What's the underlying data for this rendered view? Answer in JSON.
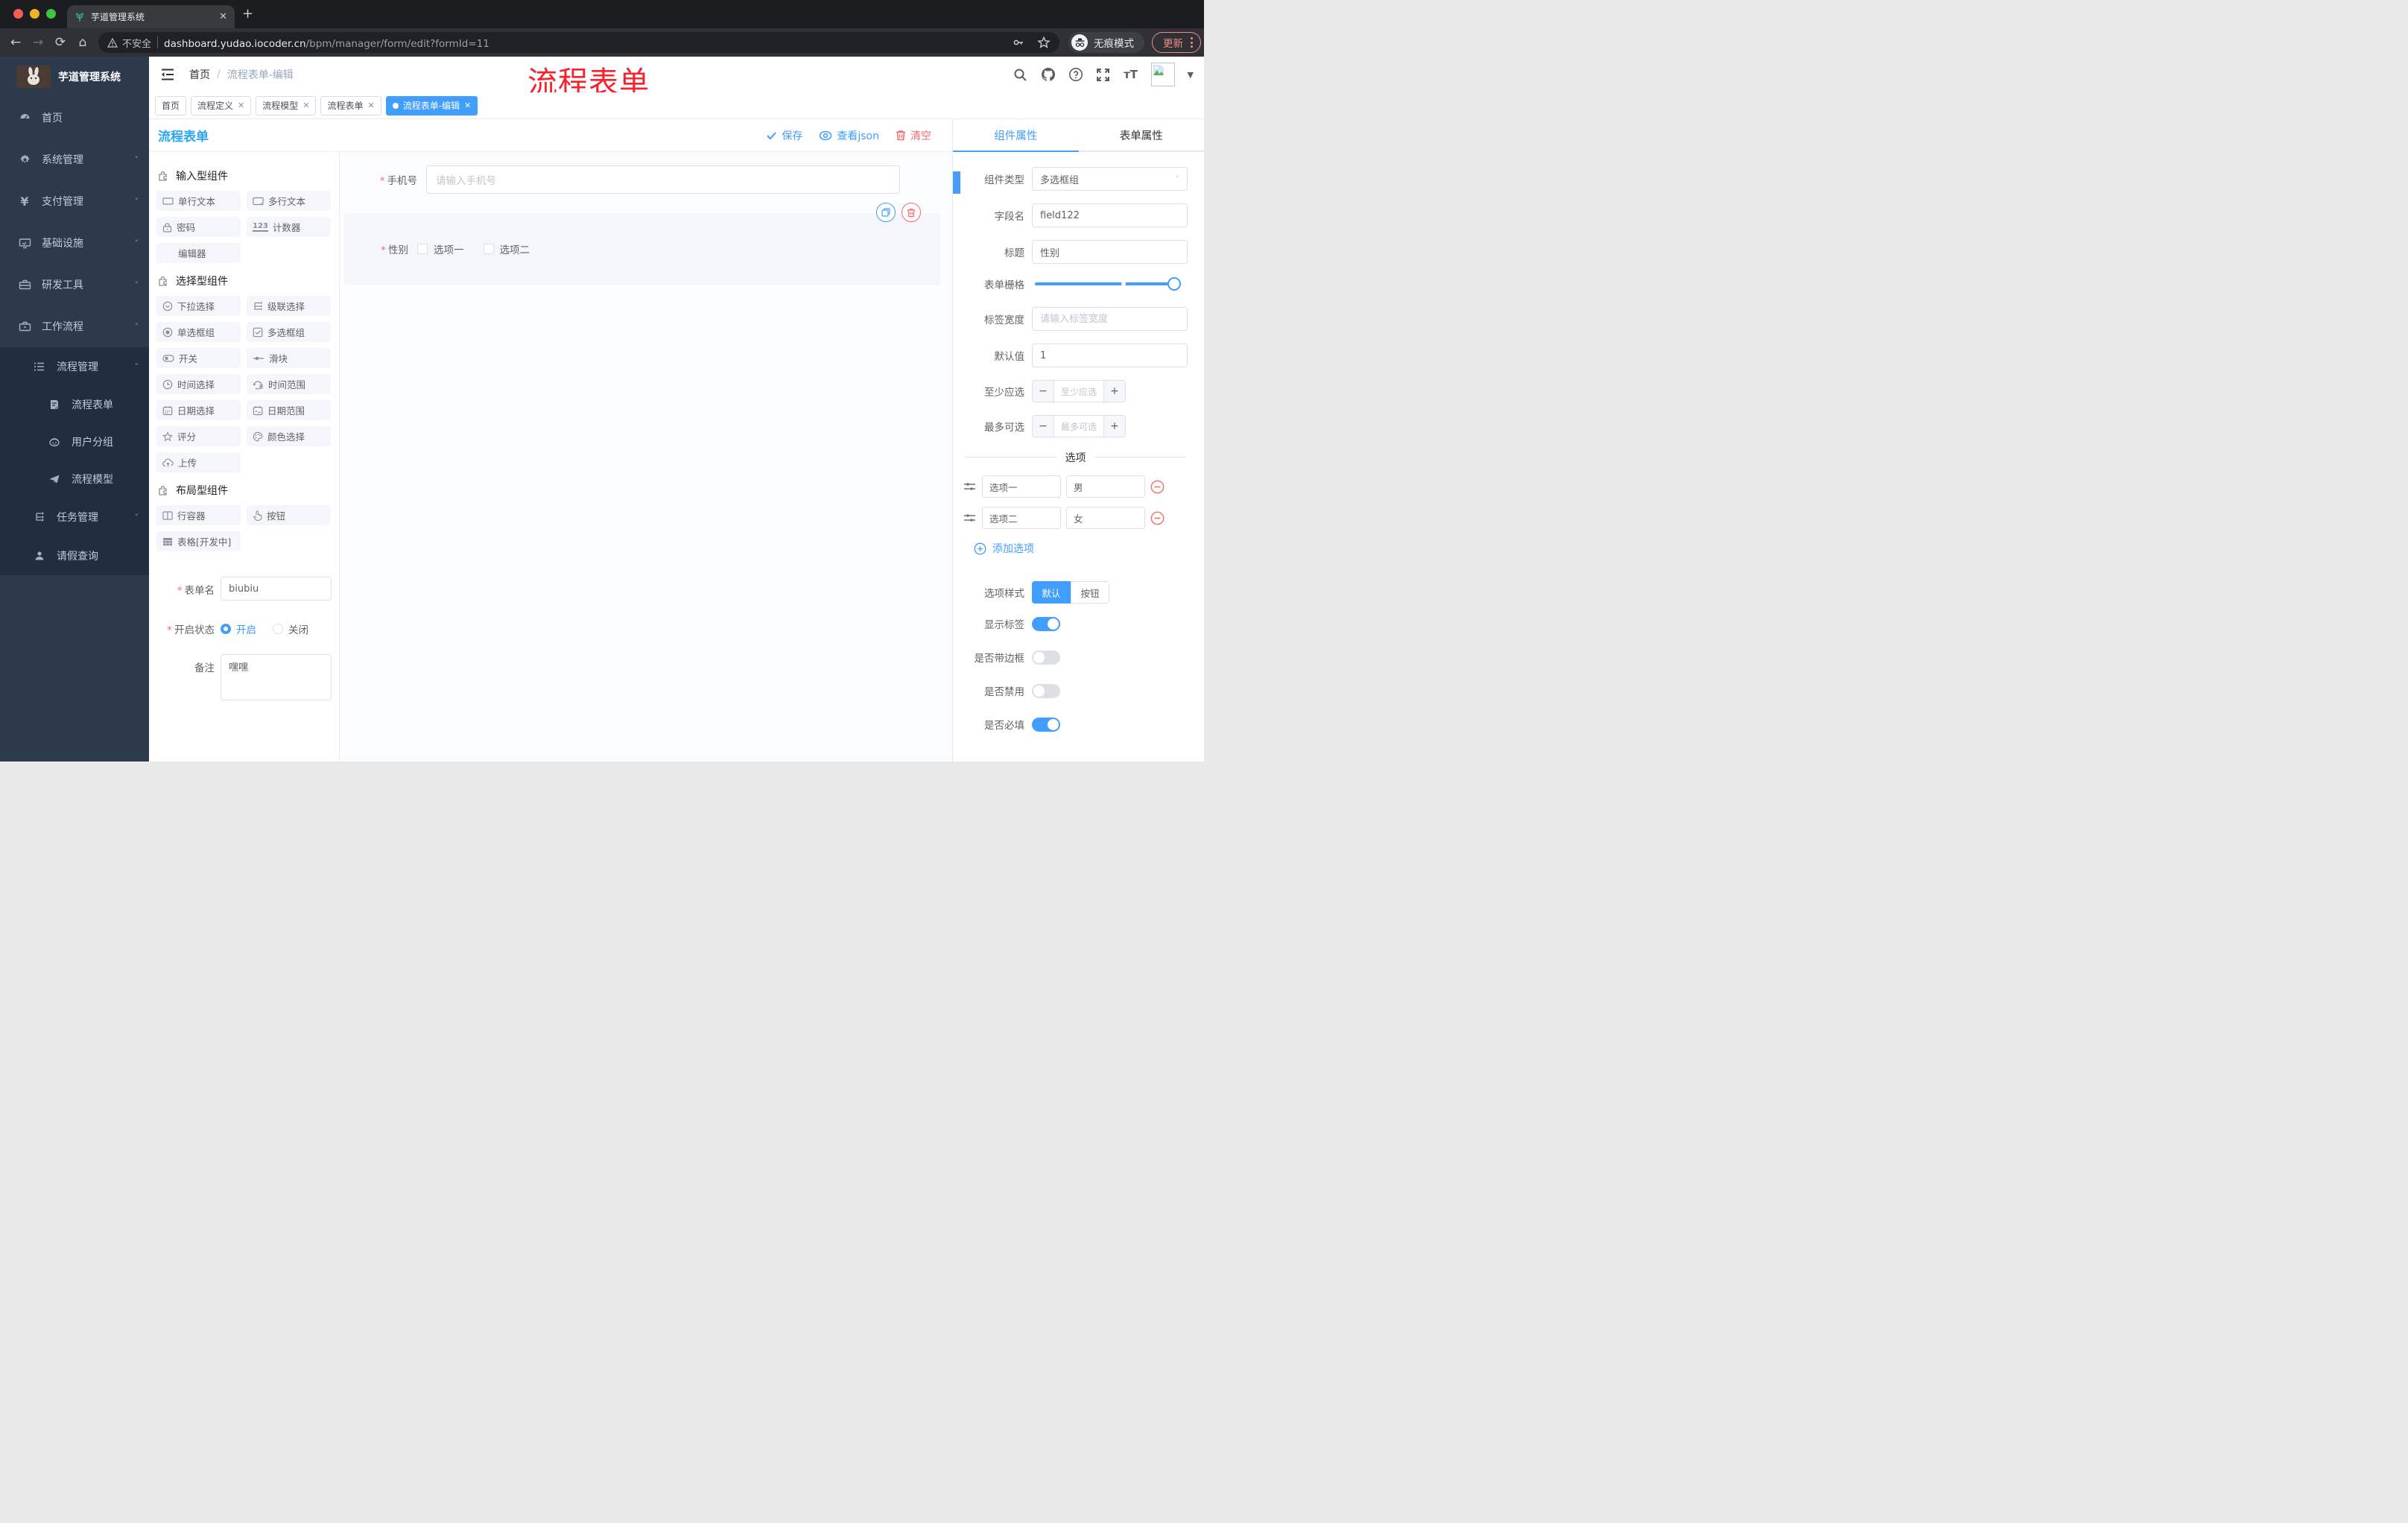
{
  "browser": {
    "tab_title": "芋道管理系统",
    "new_tab": "+",
    "close_glyph": "✕",
    "security_label": "不安全",
    "url_host": "dashboard.yudao.iocoder.cn",
    "url_path": "/bpm/manager/form/edit?formId=11",
    "incognito_label": "无痕模式",
    "update_label": "更新",
    "back": "←",
    "forward": "→",
    "reload": "⟳",
    "home": "⌂"
  },
  "sidebar": {
    "app_title": "芋道管理系统",
    "items": [
      {
        "label": "首页"
      },
      {
        "label": "系统管理",
        "arrow": "˅"
      },
      {
        "label": "支付管理",
        "arrow": "˅"
      },
      {
        "label": "基础设施",
        "arrow": "˅"
      },
      {
        "label": "研发工具",
        "arrow": "˅"
      },
      {
        "label": "工作流程",
        "arrow": "˄"
      },
      {
        "label": "流程管理",
        "arrow": "˄"
      },
      {
        "label": "流程表单"
      },
      {
        "label": "用户分组"
      },
      {
        "label": "流程模型"
      },
      {
        "label": "任务管理",
        "arrow": "˅"
      },
      {
        "label": "请假查询"
      }
    ]
  },
  "header": {
    "breadcrumb_home": "首页",
    "breadcrumb_sep": "/",
    "breadcrumb_current": "流程表单-编辑",
    "overlay_title": "流程表单",
    "font_icon_text": "тT"
  },
  "tags": [
    {
      "label": "首页"
    },
    {
      "label": "流程定义"
    },
    {
      "label": "流程模型"
    },
    {
      "label": "流程表单"
    },
    {
      "label": "流程表单-编辑"
    }
  ],
  "builder": {
    "title": "流程表单",
    "save_label": "保存",
    "view_json_label": "查看json",
    "clear_label": "清空",
    "sections": [
      {
        "title": "输入型组件"
      },
      {
        "title": "选择型组件"
      },
      {
        "title": "布局型组件"
      }
    ],
    "chips": {
      "input_items": [
        "单行文本",
        "多行文本",
        "密码",
        "计数器",
        "编辑器"
      ],
      "select_items": [
        "下拉选择",
        "级联选择",
        "单选框组",
        "多选框组",
        "开关",
        "滑块",
        "时间选择",
        "时间范围",
        "日期选择",
        "日期范围",
        "评分",
        "颜色选择",
        "上传"
      ],
      "layout_items": [
        "行容器",
        "按钮",
        "表格[开发中]"
      ]
    },
    "counter_icon_text": "123",
    "meta_form": {
      "form_name_label": "表单名",
      "form_name_value": "biubiu",
      "status_label": "开启状态",
      "status_on": "开启",
      "status_off": "关闭",
      "remark_label": "备注",
      "remark_value": "嘿嘿"
    },
    "canvas": {
      "phone_label": "手机号",
      "phone_placeholder": "请输入手机号",
      "gender_label": "性别",
      "gender_option1": "选项一",
      "gender_option2": "选项二"
    }
  },
  "props": {
    "tab_component": "组件属性",
    "tab_form": "表单属性",
    "component_type_label": "组件类型",
    "component_type_value": "多选框组",
    "field_name_label": "字段名",
    "field_name_value": "field122",
    "title_label": "标题",
    "title_value": "性别",
    "grid_label": "表单栅格",
    "label_width_label": "标签宽度",
    "label_width_placeholder": "请输入标签宽度",
    "default_label": "默认值",
    "default_value": "1",
    "min_label": "至少应选",
    "min_placeholder": "至少应选",
    "max_label": "最多可选",
    "max_placeholder": "最多可选",
    "options_title": "选项",
    "options": [
      {
        "label": "选项一",
        "value": "男"
      },
      {
        "label": "选项二",
        "value": "女"
      }
    ],
    "add_option_label": "添加选项",
    "option_style_label": "选项样式",
    "option_style_default": "默认",
    "option_style_button": "按钮",
    "option_style_selected": "默认",
    "show_label_label": "显示标签",
    "show_label_on": true,
    "border_label": "是否带边框",
    "border_on": false,
    "disabled_label": "是否禁用",
    "disabled_on": false,
    "required_label": "是否必填",
    "required_on": true
  },
  "colors": {
    "accent_blue": "#409eff",
    "builder_title_blue": "#2aa7f4",
    "danger_red": "#f56c6c",
    "overlay_red": "#f5222d",
    "sidebar_bg": "#2d3a4b",
    "active_tag_bg": "#409eff"
  }
}
